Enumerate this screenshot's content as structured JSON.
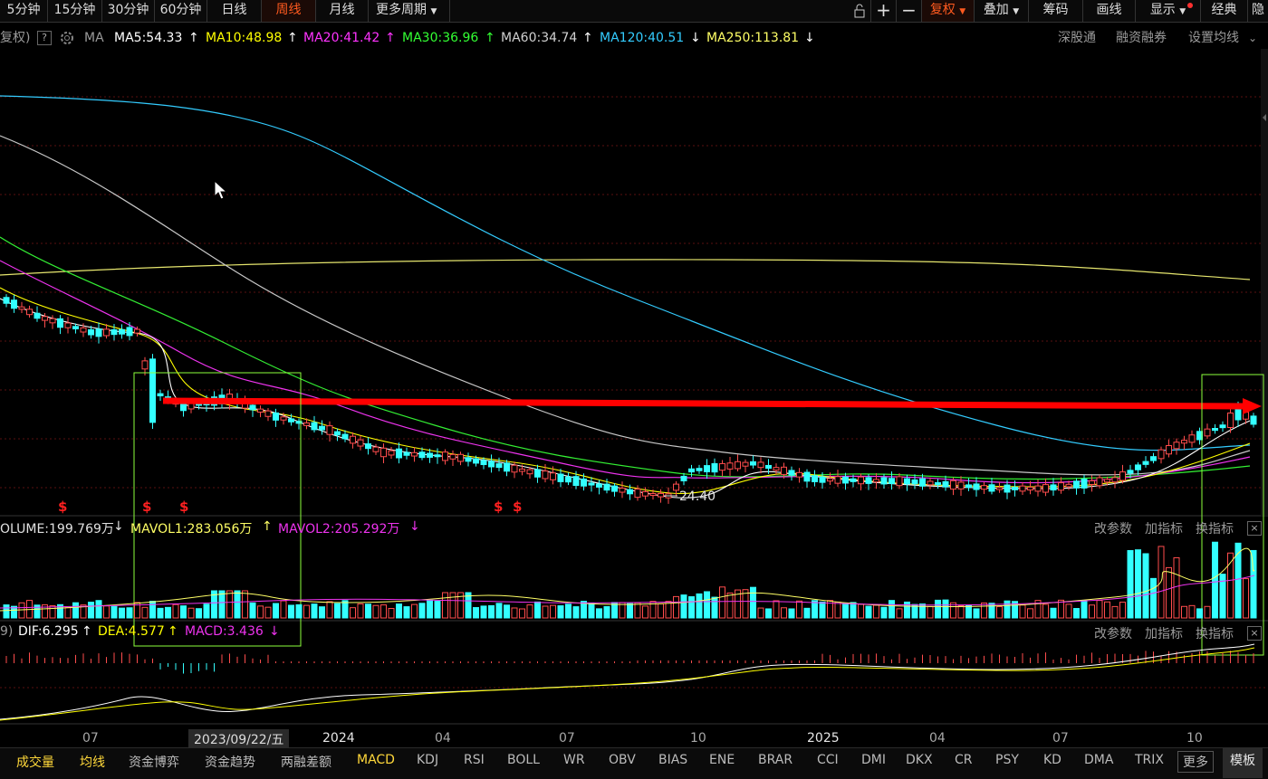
{
  "toolbar": {
    "periods": [
      "5分钟",
      "15分钟",
      "30分钟",
      "60分钟",
      "日线",
      "周线",
      "月线",
      "更多周期"
    ],
    "active_period": "周线",
    "right": [
      "复权",
      "叠加",
      "筹码",
      "画线",
      "显示",
      "经典",
      "隐"
    ]
  },
  "ma_bar": {
    "prefix": "复权)",
    "help": "?",
    "ma_label": "MA",
    "ma5": "MA5:54.33",
    "ma10": "MA10:48.98",
    "ma20": "MA20:41.42",
    "ma30": "MA30:36.96",
    "ma60": "MA60:34.74",
    "ma120": "MA120:40.51",
    "ma250": "MA250:113.81",
    "arrows": [
      "↑",
      "↑",
      "↑",
      "↑",
      "↑",
      "↓",
      "↓"
    ],
    "links": [
      "深股通",
      "融资融券",
      "设置均线"
    ]
  },
  "colors": {
    "ma5": "#ffffff",
    "ma10": "#ffff00",
    "ma20": "#ff33ff",
    "ma30": "#33ff33",
    "ma60": "#c8c8c8",
    "ma120": "#33ccff",
    "ma250": "#ffff66",
    "up": "#ff4d4d",
    "down": "#33ffff",
    "arrow": "#ff0000",
    "box": "#8cff3c"
  },
  "price_chart": {
    "low_label": "24.40",
    "s_marker": "$"
  },
  "volume": {
    "volume": "OLUME:199.769万",
    "mavol1": "MAVOL1:283.056万",
    "mavol2": "MAVOL2:205.292万",
    "arrows": [
      "↓",
      "↑",
      "↓"
    ],
    "links": [
      "改参数",
      "加指标",
      "换指标"
    ],
    "close": "×"
  },
  "macd": {
    "prefix": "9)",
    "dif": "DIF:6.295",
    "dea": "DEA:4.577",
    "macd": "MACD:3.436",
    "arrows": [
      "↑",
      "↑",
      "↓"
    ],
    "links": [
      "改参数",
      "加指标",
      "换指标"
    ],
    "close": "×"
  },
  "x_axis": {
    "labels": [
      "07",
      "2023/09/22/五",
      "2024",
      "04",
      "07",
      "10",
      "2025",
      "04",
      "07",
      "10"
    ]
  },
  "bottom_tabs": [
    "成交量",
    "均线",
    "资金博弈",
    "资金趋势",
    "两融差额",
    "MACD",
    "KDJ",
    "RSI",
    "BOLL",
    "WR",
    "OBV",
    "BIAS",
    "ENE",
    "BRAR",
    "CCI",
    "DMI",
    "DKX",
    "CR",
    "PSY",
    "KD",
    "DMA",
    "TRIX",
    "更多",
    "模板"
  ]
}
